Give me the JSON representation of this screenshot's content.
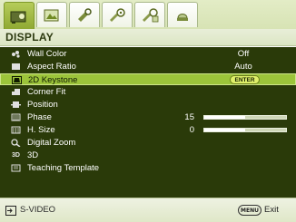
{
  "tabs": [
    {
      "icon": "display-icon",
      "active": true
    },
    {
      "icon": "picture-icon",
      "active": false
    },
    {
      "icon": "setup-icon",
      "active": false
    },
    {
      "icon": "advanced-setup-icon",
      "active": false
    },
    {
      "icon": "system-setup-icon",
      "active": false
    },
    {
      "icon": "information-icon",
      "active": false
    }
  ],
  "heading": "DISPLAY",
  "menu": {
    "items": [
      {
        "label": "Wall Color",
        "value": "Off",
        "icon": "wall-color-icon"
      },
      {
        "label": "Aspect Ratio",
        "value": "Auto",
        "icon": "aspect-ratio-icon"
      },
      {
        "label": "2D Keystone",
        "enter": "ENTER",
        "icon": "keystone-icon",
        "selected": true
      },
      {
        "label": "Corner Fit",
        "icon": "corner-fit-icon"
      },
      {
        "label": "Position",
        "icon": "position-icon"
      },
      {
        "label": "Phase",
        "number": "15",
        "level": 0.5,
        "icon": "phase-icon"
      },
      {
        "label": "H. Size",
        "number": "0",
        "level": 0.5,
        "icon": "h-size-icon"
      },
      {
        "label": "Digital Zoom",
        "icon": "digital-zoom-icon"
      },
      {
        "label": "3D",
        "icon": "3d-icon",
        "icon_text": "3D"
      },
      {
        "label": "Teaching Template",
        "icon": "teaching-template-icon"
      }
    ]
  },
  "footer": {
    "source": "S-VIDEO",
    "menu_key": "MENU",
    "exit": "Exit"
  },
  "colors": {
    "panel": "#2a3a09",
    "selected": "#9cc43a",
    "tab_active": "#9cb63e"
  }
}
